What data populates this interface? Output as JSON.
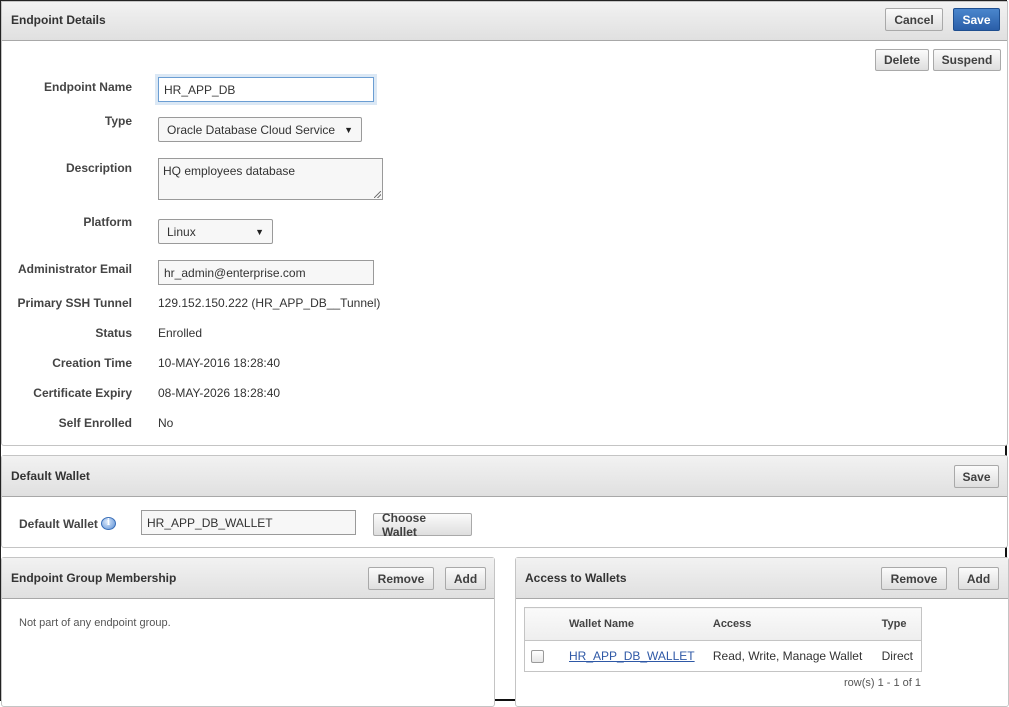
{
  "endpoint_details": {
    "title": "Endpoint Details",
    "cancel_label": "Cancel",
    "save_label": "Save",
    "delete_label": "Delete",
    "suspend_label": "Suspend",
    "fields": {
      "endpoint_name": {
        "label": "Endpoint Name",
        "value": "HR_APP_DB"
      },
      "type": {
        "label": "Type",
        "value": "Oracle Database Cloud Service"
      },
      "description": {
        "label": "Description",
        "value": "HQ employees database"
      },
      "platform": {
        "label": "Platform",
        "value": "Linux"
      },
      "admin_email": {
        "label": "Administrator Email",
        "value": "hr_admin@enterprise.com"
      },
      "ssh_tunnel": {
        "label": "Primary SSH Tunnel",
        "value": "129.152.150.222 (HR_APP_DB__Tunnel)"
      },
      "status": {
        "label": "Status",
        "value": "Enrolled"
      },
      "creation_time": {
        "label": "Creation Time",
        "value": "10-MAY-2016 18:28:40"
      },
      "cert_expiry": {
        "label": "Certificate Expiry",
        "value": "08-MAY-2026 18:28:40"
      },
      "self_enrolled": {
        "label": "Self Enrolled",
        "value": "No"
      }
    }
  },
  "default_wallet": {
    "title": "Default Wallet",
    "save_label": "Save",
    "field_label": "Default Wallet",
    "value": "HR_APP_DB_WALLET",
    "choose_label": "Choose Wallet",
    "info_icon": "i"
  },
  "group_membership": {
    "title": "Endpoint Group Membership",
    "remove_label": "Remove",
    "add_label": "Add",
    "empty_message": "Not part of any endpoint group."
  },
  "access_wallets": {
    "title": "Access to Wallets",
    "remove_label": "Remove",
    "add_label": "Add",
    "columns": [
      "Wallet Name",
      "Access",
      "Type"
    ],
    "rows": [
      {
        "wallet_name": "HR_APP_DB_WALLET",
        "access": "Read, Write, Manage Wallet",
        "type": "Direct"
      }
    ],
    "pagination": "row(s) 1 - 1 of 1"
  },
  "colors": {
    "primary_button": "#2a5ea8",
    "link": "#2e58a6",
    "header_bg": "#e6e6e6"
  }
}
